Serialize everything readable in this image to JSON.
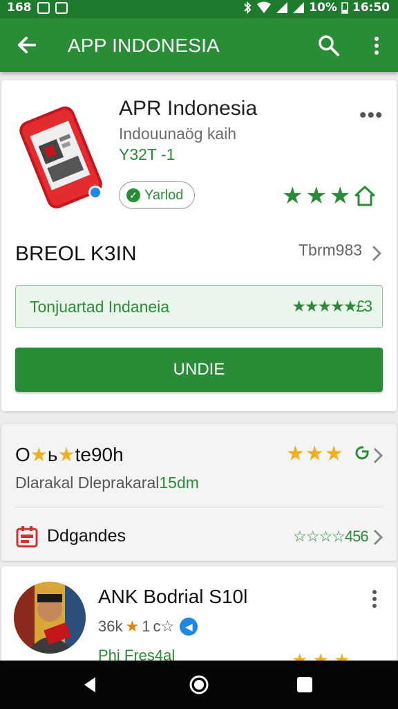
{
  "status_bar": {
    "left_text": "168",
    "battery": "10%",
    "time": "16:50"
  },
  "app_bar": {
    "title": "APP INDONESIA"
  },
  "app_card": {
    "name": "APR Indonesia",
    "developer": "Indouunaög kaih",
    "version": "Y32T -1",
    "chip_label": "Yarlod",
    "section_title": "BREOL K3IN",
    "section_meta": "Tbrm983",
    "highlight_text": "Tonjuartad Indaneia",
    "highlight_rating": "★★★★★£3",
    "install_label": "UNDIE"
  },
  "rating_card": {
    "title_pre": "O",
    "title_mid": "ь",
    "title_post": "te90h",
    "subtitle": "Dlarakal Dleprakaral",
    "subtitle_suffix": "15dm",
    "category_label": "Ddgandes",
    "category_rating": "☆☆☆☆456"
  },
  "publisher_card": {
    "name": "ANK Bodrial S10l",
    "meta_count": "36k",
    "meta_rating": "1",
    "meta_rating_suffix": "c☆",
    "green_text": "Phi Fres4al"
  },
  "colors": {
    "primary_green": "#2a8c37",
    "status_green": "#1e7a2c",
    "star_yellow": "#f2b01e"
  }
}
